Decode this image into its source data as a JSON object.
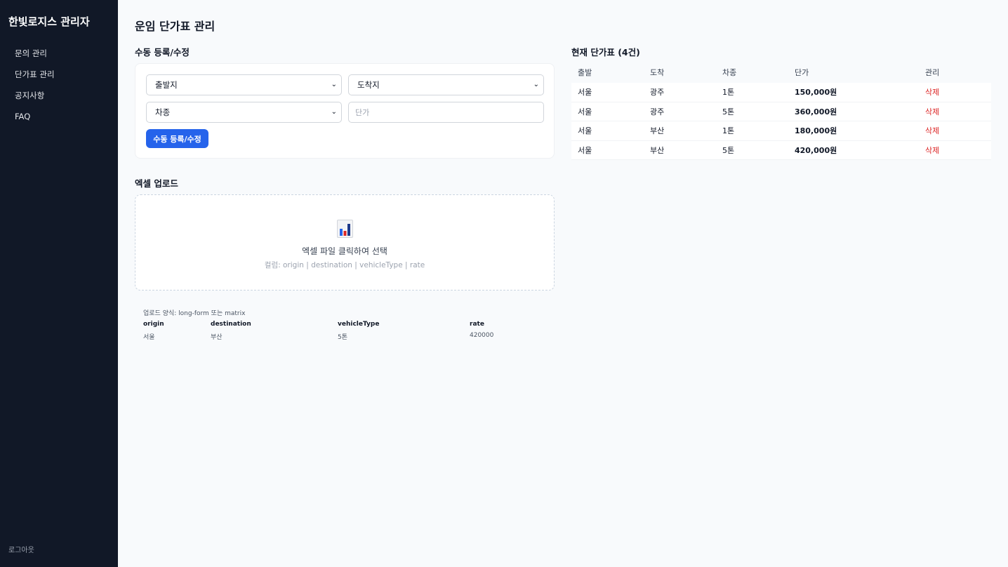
{
  "sidebar": {
    "brand": "한빛로지스 관리자",
    "items": [
      {
        "label": "문의 관리"
      },
      {
        "label": "단가표 관리"
      },
      {
        "label": "공지사항"
      },
      {
        "label": "FAQ"
      }
    ],
    "logout": "로그아웃"
  },
  "page": {
    "title": "운임 단가표 관리"
  },
  "manual": {
    "title": "수동 등록/수정",
    "origin_value": "출발지",
    "destination_value": "도착지",
    "vehicle_value": "차종",
    "rate_placeholder": "단가",
    "submit_label": "수동 등록/수정"
  },
  "upload": {
    "title": "엑셀 업로드",
    "icon": "bar-chart-icon",
    "drop_title": "엑셀 파일 클릭하여 선택",
    "drop_hint": "컬럼: origin | destination | vehicleType | rate",
    "format_label": "업로드 양식: long-form 또는 matrix",
    "format_columns": [
      "origin",
      "destination",
      "vehicleType",
      "rate"
    ],
    "format_example": [
      "서울",
      "부산",
      "5톤",
      "420000"
    ]
  },
  "rates": {
    "title": "현재 단가표 (4건)",
    "columns": [
      "출발",
      "도착",
      "차종",
      "단가",
      "관리"
    ],
    "rows": [
      {
        "origin": "서울",
        "destination": "광주",
        "vehicle": "1톤",
        "rate": "150,000원",
        "action": "삭제"
      },
      {
        "origin": "서울",
        "destination": "광주",
        "vehicle": "5톤",
        "rate": "360,000원",
        "action": "삭제"
      },
      {
        "origin": "서울",
        "destination": "부산",
        "vehicle": "1톤",
        "rate": "180,000원",
        "action": "삭제"
      },
      {
        "origin": "서울",
        "destination": "부산",
        "vehicle": "5톤",
        "rate": "420,000원",
        "action": "삭제"
      }
    ]
  },
  "colors": {
    "sidebar_bg": "#111827",
    "primary": "#2563eb",
    "danger": "#dc2626",
    "page_bg": "#f8fafc"
  }
}
